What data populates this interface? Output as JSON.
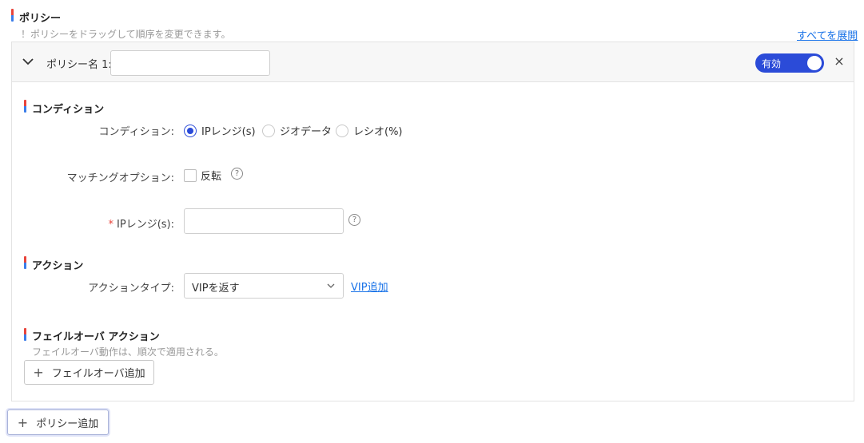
{
  "header": {
    "title": "ポリシー",
    "hint": "！ポリシーをドラッグして順序を変更できます。",
    "expand_all": "すべてを展開"
  },
  "policy": {
    "name_label": "ポリシー名 1:",
    "name_value": "",
    "toggle_label": "有効",
    "toggle_on": true,
    "close": "×"
  },
  "condition": {
    "section_title": "コンディション",
    "condition_label": "コンディション:",
    "options": [
      "IPレンジ(s)",
      "ジオデータ",
      "レシオ(%)"
    ],
    "selected": "IPレンジ(s)",
    "matching_label": "マッチングオプション:",
    "invert_label": "反転",
    "ip_label": "IPレンジ(s):",
    "ip_required": "*",
    "ip_value": ""
  },
  "action": {
    "section_title": "アクション",
    "type_label": "アクションタイプ:",
    "type_value": "VIPを返す",
    "add_vip": "VIP追加"
  },
  "failover": {
    "section_title": "フェイルオーバ アクション",
    "hint": "フェイルオーバ動作は、順次で適用される。",
    "add_button": "フェイルオーバ追加"
  },
  "footer": {
    "add_policy": "ポリシー追加"
  },
  "icons": {
    "plus": "+",
    "question": "?"
  },
  "colors": {
    "accent": "#2b4bd8",
    "link": "#1a73e8",
    "marker_red": "#e8443b",
    "marker_blue": "#3b7de9"
  }
}
